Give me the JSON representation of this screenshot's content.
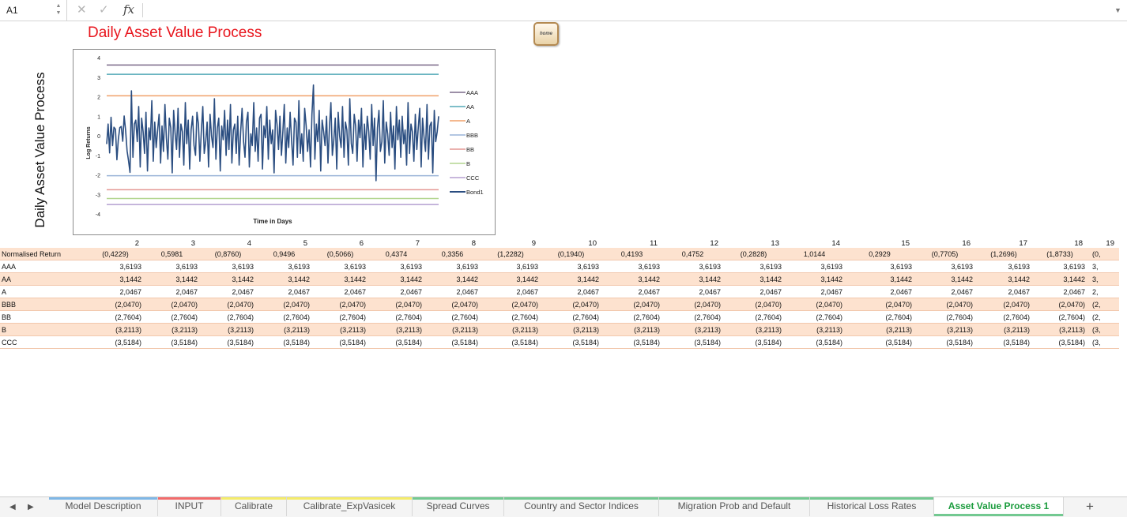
{
  "formula_bar": {
    "cell_ref": "A1",
    "formula_value": "",
    "icons": [
      "cancel-icon",
      "confirm-icon",
      "function-icon"
    ],
    "fx_label": "fx"
  },
  "sheet": {
    "title": "Daily Asset Value Process",
    "home_button_label": "home",
    "side_title": "Daily Asset Value Process",
    "title_color": "#e8141c"
  },
  "chart_data": {
    "type": "line",
    "title": "",
    "xlabel": "Time in Days",
    "ylabel": "Log Returns",
    "ylim": [
      -4,
      4
    ],
    "yticks": [
      "4",
      "3",
      "2",
      "1",
      "0",
      "-1",
      "-2",
      "-3",
      "-4"
    ],
    "grid": false,
    "legend_position": "right",
    "horizontal_series": [
      {
        "name": "AAA",
        "value": 3.6193,
        "color": "#7b6a8a"
      },
      {
        "name": "AA",
        "value": 3.1442,
        "color": "#53a9b7"
      },
      {
        "name": "A",
        "value": 2.0467,
        "color": "#f0a06a"
      },
      {
        "name": "BBB",
        "value": -2.047,
        "color": "#9ab4d8"
      },
      {
        "name": "BB",
        "value": -2.7604,
        "color": "#e49793"
      },
      {
        "name": "B",
        "value": -3.2113,
        "color": "#b3d690"
      },
      {
        "name": "CCC",
        "value": -3.5184,
        "color": "#b59fd1"
      }
    ],
    "bond_series": {
      "name": "Bond1",
      "color": "#2a4d80",
      "values": [
        -0.4229,
        0.5981,
        -0.876,
        0.9496,
        -0.5066,
        0.4374,
        0.3356,
        -1.2282,
        -0.194,
        0.4193,
        0.4752,
        -0.2828,
        1.0144,
        0.2929,
        -0.7705,
        -1.2696,
        -1.8733,
        2.3,
        -1.1,
        0.6,
        0.8,
        -0.3,
        1.5,
        -1.6,
        0.9,
        0.2,
        -0.9,
        1.2,
        -1.8,
        0.4,
        -0.2,
        1.8,
        -1.3,
        0.7,
        -0.6,
        0.3,
        1.1,
        -1.4,
        0.5,
        -0.8,
        1.6,
        -0.1,
        -1.2,
        0.9,
        0.4,
        -1.9,
        1.3,
        0.1,
        -0.7,
        1.4,
        -1.1,
        0.6,
        0.2,
        -1.5,
        1.7,
        -0.4,
        0.8,
        -1.7,
        0.3,
        1.0,
        -0.5,
        -1.0,
        1.2,
        0.6,
        -1.3,
        0.2,
        1.5,
        -0.9,
        -0.3,
        0.7,
        -1.6,
        1.1,
        0.0,
        -0.6,
        1.9,
        -1.2,
        0.4,
        0.9,
        -1.8,
        0.5,
        -0.2,
        1.3,
        -1.0,
        0.8,
        -0.7,
        1.6,
        -1.4,
        0.3,
        0.6,
        -0.9,
        1.0,
        -1.5,
        0.2,
        1.4,
        -0.3,
        -1.1,
        0.7,
        1.2,
        -1.6,
        0.1,
        -0.5,
        1.7,
        -0.8,
        0.4,
        -1.3,
        0.9,
        1.1,
        -1.7,
        0.5,
        -0.1,
        1.5,
        -1.2,
        0.8,
        -0.4,
        0.3,
        -1.9,
        1.3,
        0.6,
        -0.7,
        1.0,
        -1.0,
        0.2,
        1.6,
        -1.4,
        0.4,
        -0.6,
        1.2,
        -0.2,
        -1.5,
        0.9,
        0.7,
        -1.1,
        1.8,
        -0.9,
        0.1,
        -1.3,
        1.4,
        0.5,
        -0.8,
        0.3,
        -1.6,
        1.1,
        2.6,
        -1.2,
        0.6,
        -0.3,
        1.3,
        -1.8,
        0.8,
        0.2,
        -0.5,
        1.0,
        -1.4,
        0.4,
        1.7,
        -1.0,
        -0.2,
        0.9,
        -1.7,
        1.2,
        0.0,
        -0.6,
        1.5,
        -1.1,
        0.7,
        0.3,
        -1.5,
        1.9,
        -0.4,
        -0.9,
        1.1,
        0.5,
        -1.3,
        0.8,
        -0.1,
        1.4,
        -1.6,
        0.6,
        -0.7,
        1.0,
        0.2,
        -1.2,
        1.6,
        -0.5,
        0.9,
        -2.3,
        0.4,
        1.3,
        -0.8,
        -0.3,
        1.8,
        -1.4,
        0.7,
        0.1,
        -1.0,
        1.2,
        -0.6,
        0.5,
        -1.7,
        1.5,
        -0.2,
        0.8,
        -1.1,
        1.0,
        -0.4,
        0.3,
        -1.5,
        1.7,
        -0.9,
        0.6,
        0.2,
        -1.3,
        1.1,
        -0.7,
        0.4,
        1.4,
        -1.6,
        0.9,
        -0.1,
        -0.8,
        1.6,
        -1.2,
        0.5,
        0.7,
        -1.9,
        1.3,
        -0.3,
        0.2,
        1.0
      ]
    }
  },
  "table": {
    "column_headers": [
      "2",
      "3",
      "4",
      "5",
      "6",
      "7",
      "8",
      "9",
      "10",
      "11",
      "12",
      "13",
      "14",
      "15",
      "16",
      "17",
      "18",
      "19"
    ],
    "rows": [
      {
        "label": "Normalised Return",
        "values": [
          "(0,4229)",
          "0,5981",
          "(0,8760)",
          "0,9496",
          "(0,5066)",
          "0,4374",
          "0,3356",
          "(1,2282)",
          "(0,1940)",
          "0,4193",
          "0,4752",
          "(0,2828)",
          "1,0144",
          "0,2929",
          "(0,7705)",
          "(1,2696)",
          "(1,8733)",
          "(0,"
        ],
        "center": true
      },
      {
        "label": "AAA",
        "values": [
          "3,6193",
          "3,6193",
          "3,6193",
          "3,6193",
          "3,6193",
          "3,6193",
          "3,6193",
          "3,6193",
          "3,6193",
          "3,6193",
          "3,6193",
          "3,6193",
          "3,6193",
          "3,6193",
          "3,6193",
          "3,6193",
          "3,6193",
          "3,"
        ]
      },
      {
        "label": "AA",
        "values": [
          "3,1442",
          "3,1442",
          "3,1442",
          "3,1442",
          "3,1442",
          "3,1442",
          "3,1442",
          "3,1442",
          "3,1442",
          "3,1442",
          "3,1442",
          "3,1442",
          "3,1442",
          "3,1442",
          "3,1442",
          "3,1442",
          "3,1442",
          "3,"
        ]
      },
      {
        "label": "A",
        "values": [
          "2,0467",
          "2,0467",
          "2,0467",
          "2,0467",
          "2,0467",
          "2,0467",
          "2,0467",
          "2,0467",
          "2,0467",
          "2,0467",
          "2,0467",
          "2,0467",
          "2,0467",
          "2,0467",
          "2,0467",
          "2,0467",
          "2,0467",
          "2,"
        ]
      },
      {
        "label": "BBB",
        "values": [
          "(2,0470)",
          "(2,0470)",
          "(2,0470)",
          "(2,0470)",
          "(2,0470)",
          "(2,0470)",
          "(2,0470)",
          "(2,0470)",
          "(2,0470)",
          "(2,0470)",
          "(2,0470)",
          "(2,0470)",
          "(2,0470)",
          "(2,0470)",
          "(2,0470)",
          "(2,0470)",
          "(2,0470)",
          "(2,"
        ]
      },
      {
        "label": "BB",
        "values": [
          "(2,7604)",
          "(2,7604)",
          "(2,7604)",
          "(2,7604)",
          "(2,7604)",
          "(2,7604)",
          "(2,7604)",
          "(2,7604)",
          "(2,7604)",
          "(2,7604)",
          "(2,7604)",
          "(2,7604)",
          "(2,7604)",
          "(2,7604)",
          "(2,7604)",
          "(2,7604)",
          "(2,7604)",
          "(2,"
        ]
      },
      {
        "label": "B",
        "values": [
          "(3,2113)",
          "(3,2113)",
          "(3,2113)",
          "(3,2113)",
          "(3,2113)",
          "(3,2113)",
          "(3,2113)",
          "(3,2113)",
          "(3,2113)",
          "(3,2113)",
          "(3,2113)",
          "(3,2113)",
          "(3,2113)",
          "(3,2113)",
          "(3,2113)",
          "(3,2113)",
          "(3,2113)",
          "(3,"
        ]
      },
      {
        "label": "CCC",
        "values": [
          "(3,5184)",
          "(3,5184)",
          "(3,5184)",
          "(3,5184)",
          "(3,5184)",
          "(3,5184)",
          "(3,5184)",
          "(3,5184)",
          "(3,5184)",
          "(3,5184)",
          "(3,5184)",
          "(3,5184)",
          "(3,5184)",
          "(3,5184)",
          "(3,5184)",
          "(3,5184)",
          "(3,5184)",
          "(3,"
        ]
      }
    ],
    "shade_color": "#fde2cf"
  },
  "tabs": [
    {
      "label": "Model Description",
      "color": "#7fb7e6"
    },
    {
      "label": "INPUT",
      "color": "#f26b6b"
    },
    {
      "label": "Calibrate",
      "color": "#f5ec6a"
    },
    {
      "label": "Calibrate_ExpVasicek",
      "color": "#f5ec6a"
    },
    {
      "label": "Spread Curves",
      "color": "#73c991"
    },
    {
      "label": "Country and Sector Indices",
      "color": "#73c991"
    },
    {
      "label": "Migration Prob and Default",
      "color": "#73c991"
    },
    {
      "label": "Historical Loss Rates",
      "color": "#73c991"
    },
    {
      "label": "Asset Value Process 1",
      "color": "#73c991",
      "active": true
    }
  ],
  "tab_nav": {
    "prev_icon": "◀",
    "next_icon": "▶",
    "add_label": "+"
  }
}
